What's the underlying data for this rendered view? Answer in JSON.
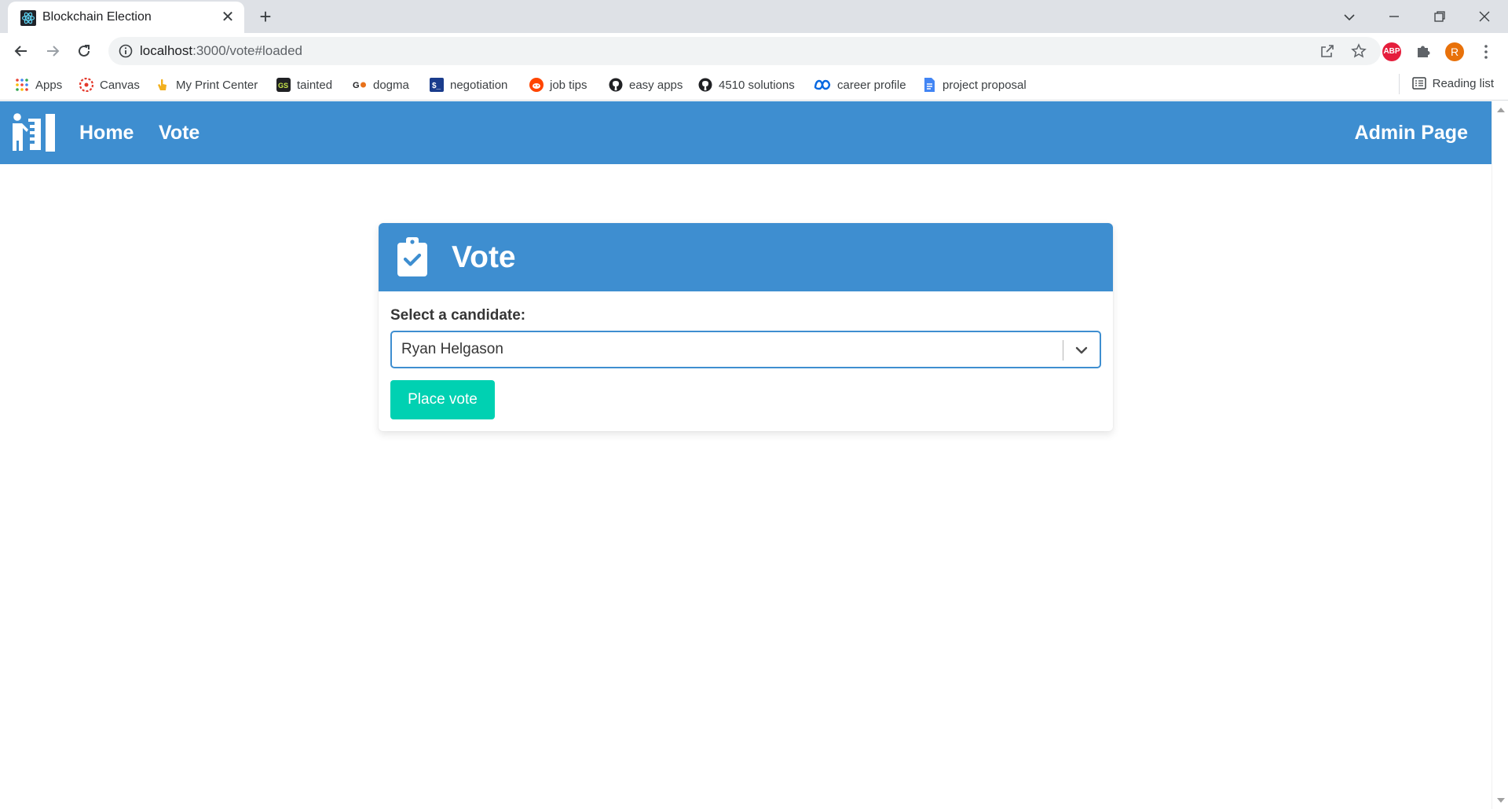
{
  "browser": {
    "tab_title": "Blockchain Election",
    "url_host": "localhost",
    "url_path": ":3000/vote#loaded",
    "profile_initial": "R",
    "abp_label": "ABP",
    "bookmarks": [
      {
        "label": "Apps",
        "icon": "apps-grid-icon",
        "color": "#ea4335"
      },
      {
        "label": "Canvas",
        "icon": "canvas-icon",
        "color": "#e4392c"
      },
      {
        "label": "My Print Center",
        "icon": "hand-pointer-icon",
        "color": "#f2b01e"
      },
      {
        "label": "tainted",
        "icon": "gs-icon",
        "color": "#202124"
      },
      {
        "label": "dogma",
        "icon": "goodreads-icon",
        "color": "#e8711a"
      },
      {
        "label": "negotiation",
        "icon": "terminal-icon",
        "color": "#1a3c8c"
      },
      {
        "label": "job tips",
        "icon": "reddit-icon",
        "color": "#ff4500"
      },
      {
        "label": "easy apps",
        "icon": "github-icon",
        "color": "#202124"
      },
      {
        "label": "4510 solutions",
        "icon": "github-icon",
        "color": "#202124"
      },
      {
        "label": "career profile",
        "icon": "meta-icon",
        "color": "#0668e1"
      },
      {
        "label": "project proposal",
        "icon": "google-docs-icon",
        "color": "#4285f4"
      }
    ],
    "reading_list": "Reading list"
  },
  "navbar": {
    "home": "Home",
    "vote": "Vote",
    "admin": "Admin Page",
    "color": "#3e8ed0"
  },
  "card": {
    "title": "Vote",
    "label": "Select a candidate:",
    "selected_candidate": "Ryan Helgason",
    "button": "Place vote",
    "button_color": "#00d1b2"
  }
}
